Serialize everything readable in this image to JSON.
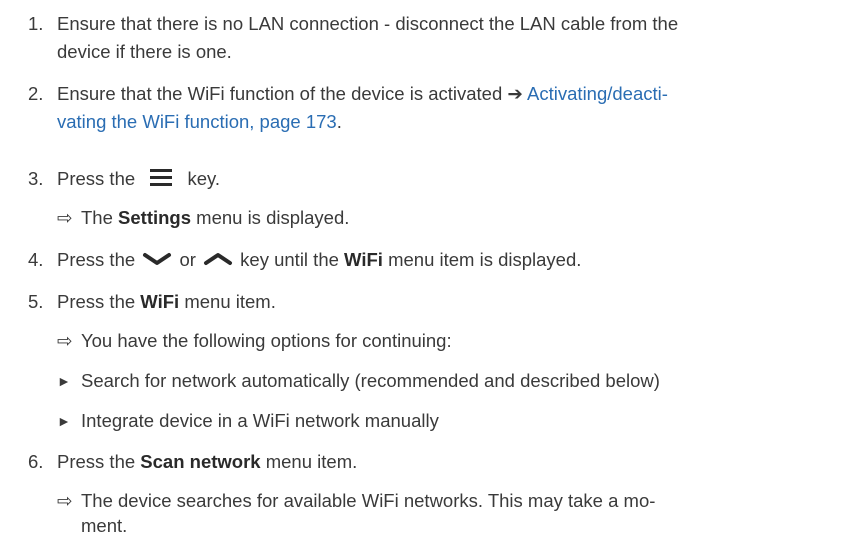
{
  "steps": [
    {
      "num": "1.",
      "line1": "Ensure that there is no LAN connection - disconnect the LAN cable from the",
      "line2": "device if there is one."
    },
    {
      "num": "2.",
      "line1_pre": "Ensure that the WiFi function of the device is activated ",
      "arrow": "➔",
      "link1": "Activating/deacti-",
      "link2": "vating the WiFi function, page 173",
      "line2_post": "."
    },
    {
      "num": "3.",
      "pre": "Press the",
      "icon": "menu-icon",
      "post": "key.",
      "result_arrow": "⇨",
      "result_pre": "The ",
      "result_bold": "Settings",
      "result_post": " menu is displayed."
    },
    {
      "num": "4.",
      "pre": "Press the",
      "icon1": "chevron-down-icon",
      "mid": "or",
      "icon2": "chevron-up-icon",
      "post_pre": "key until the ",
      "bold": "WiFi",
      "post": " menu item is displayed."
    },
    {
      "num": "5.",
      "pre": "Press the ",
      "bold": "WiFi",
      "post": " menu item.",
      "result_arrow": "⇨",
      "result": "You have the following options for continuing:",
      "bullet": "►",
      "option1": "Search for network automatically (recommended and described below)",
      "option2": "Integrate device in a WiFi network manually"
    },
    {
      "num": "6.",
      "pre": "Press the ",
      "bold": "Scan network",
      "post": " menu item.",
      "result_arrow": "⇨",
      "result1": "The device searches for available WiFi networks. This may take a mo-",
      "result2": "ment."
    }
  ],
  "colors": {
    "text": "#3a3a3a",
    "link": "#2a6db3"
  }
}
